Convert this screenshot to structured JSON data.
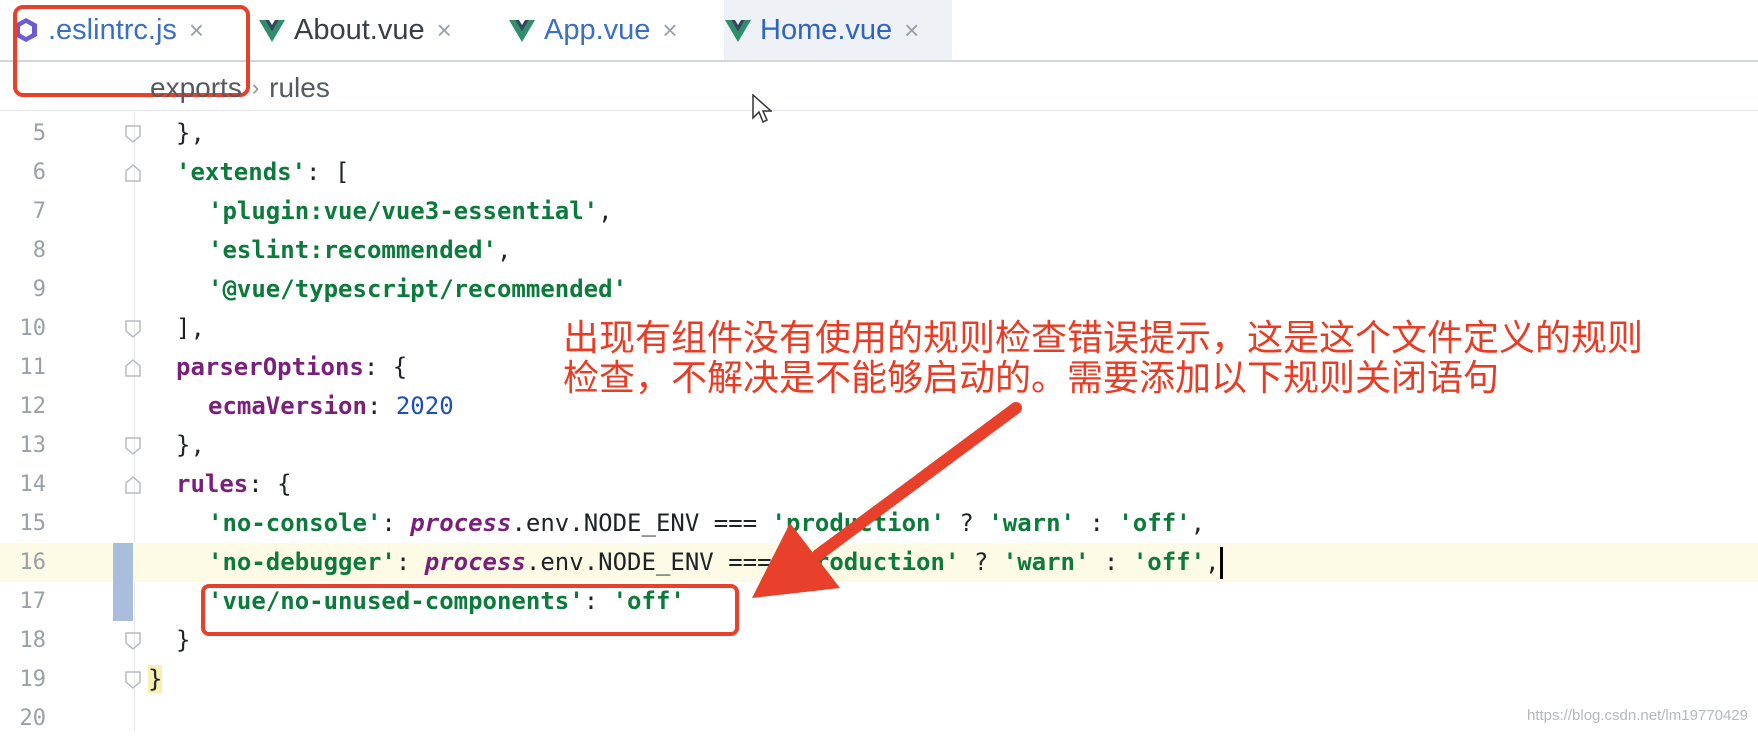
{
  "tabs": [
    {
      "label": ".eslintrc.js",
      "icon": "eslint-icon",
      "active": true
    },
    {
      "label": "About.vue",
      "icon": "vue-icon",
      "active": false
    },
    {
      "label": "App.vue",
      "icon": "vue-icon",
      "active": false
    },
    {
      "label": "Home.vue",
      "icon": "vue-icon",
      "active": false
    }
  ],
  "tab_close_glyph": "×",
  "breadcrumb": [
    "exports",
    "rules"
  ],
  "breadcrumb_sep": "›",
  "lines": [
    {
      "n": "5"
    },
    {
      "n": "6"
    },
    {
      "n": "7"
    },
    {
      "n": "8"
    },
    {
      "n": "9"
    },
    {
      "n": "10"
    },
    {
      "n": "11"
    },
    {
      "n": "12"
    },
    {
      "n": "13"
    },
    {
      "n": "14"
    },
    {
      "n": "15"
    },
    {
      "n": "16"
    },
    {
      "n": "17"
    },
    {
      "n": "18"
    },
    {
      "n": "19"
    },
    {
      "n": "20"
    }
  ],
  "code": {
    "l5": "},",
    "l6_key": "'extends'",
    "l6_rest": ": [",
    "l7": "'plugin:vue/vue3-essential'",
    "l8": "'eslint:recommended'",
    "l9": "'@vue/typescript/recommended'",
    "l10": "],",
    "l11_key": "parserOptions",
    "l11_rest": ": {",
    "l12_key": "ecmaVersion",
    "l12_num": "2020",
    "l13": "},",
    "l14_key": "rules",
    "l14_rest": ": {",
    "l15_key": "'no-console'",
    "l15_proc": "process",
    "l15_env": ".env.NODE_ENV === ",
    "l15_prod": "'production'",
    "l15_warn": "'warn'",
    "l15_off": "'off'",
    "l16_key": "'no-debugger'",
    "l16_proc": "process",
    "l16_env": ".env.NODE_ENV === ",
    "l16_prod": "'production'",
    "l16_warn": "'warn'",
    "l16_off": "'off'",
    "l17_key": "'vue/no-unused-components'",
    "l17_off": "'off'",
    "l18": "}",
    "l19": "}"
  },
  "annotation": {
    "line1": "出现有组件没有使用的规则检查错误提示，这是这个文件定义的规则",
    "line2": "检查，不解决是不能够启动的。需要添加以下规则关闭语句"
  },
  "watermark": "https://blog.csdn.net/lm19770429",
  "colors": {
    "highlight": "#e8402a",
    "annotation": "#ea3b24"
  }
}
